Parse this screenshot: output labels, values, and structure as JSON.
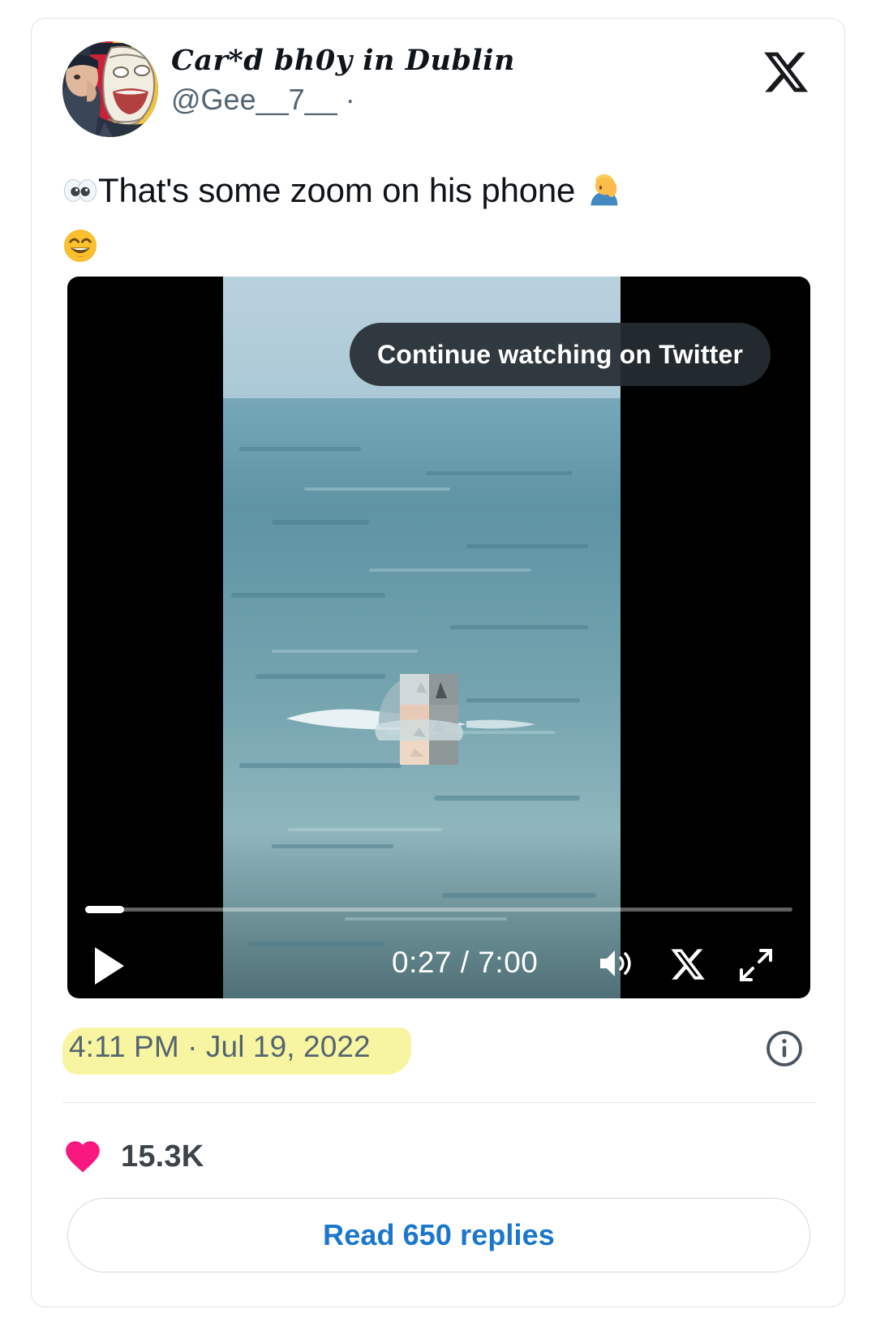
{
  "card": {
    "platform_logo": "x-logo"
  },
  "author": {
    "display_name": "Car*d bh0y in Dublin",
    "handle": "@Gee__7__",
    "separator": "·",
    "avatar_alt": "avatar"
  },
  "tweet": {
    "text_before": "That's some zoom on his phone",
    "emoji_eyes": "👀",
    "emoji_facepalm": "🤦",
    "emoji_grin": "😄"
  },
  "video": {
    "overlay_button": "Continue watching on Twitter",
    "current_time": "0:27",
    "total_time": "7:00",
    "time_display": "0:27 / 7:00",
    "progress_percent": 6,
    "play_state": "paused",
    "icons": {
      "play": "play-icon",
      "volume": "volume-icon",
      "platform": "x-icon",
      "fullscreen": "fullscreen-icon"
    }
  },
  "meta": {
    "timestamp": "4:11 PM · Jul 19, 2022",
    "time": "4:11 PM",
    "date": "Jul 19, 2022",
    "info_icon": "info-icon",
    "highlight_color": "#f7f49a"
  },
  "engagement": {
    "like_count": "15.3K",
    "heart_color": "#f91880",
    "replies_label": "Read 650 replies",
    "replies_count": "650",
    "link_color": "#1b77cc"
  }
}
